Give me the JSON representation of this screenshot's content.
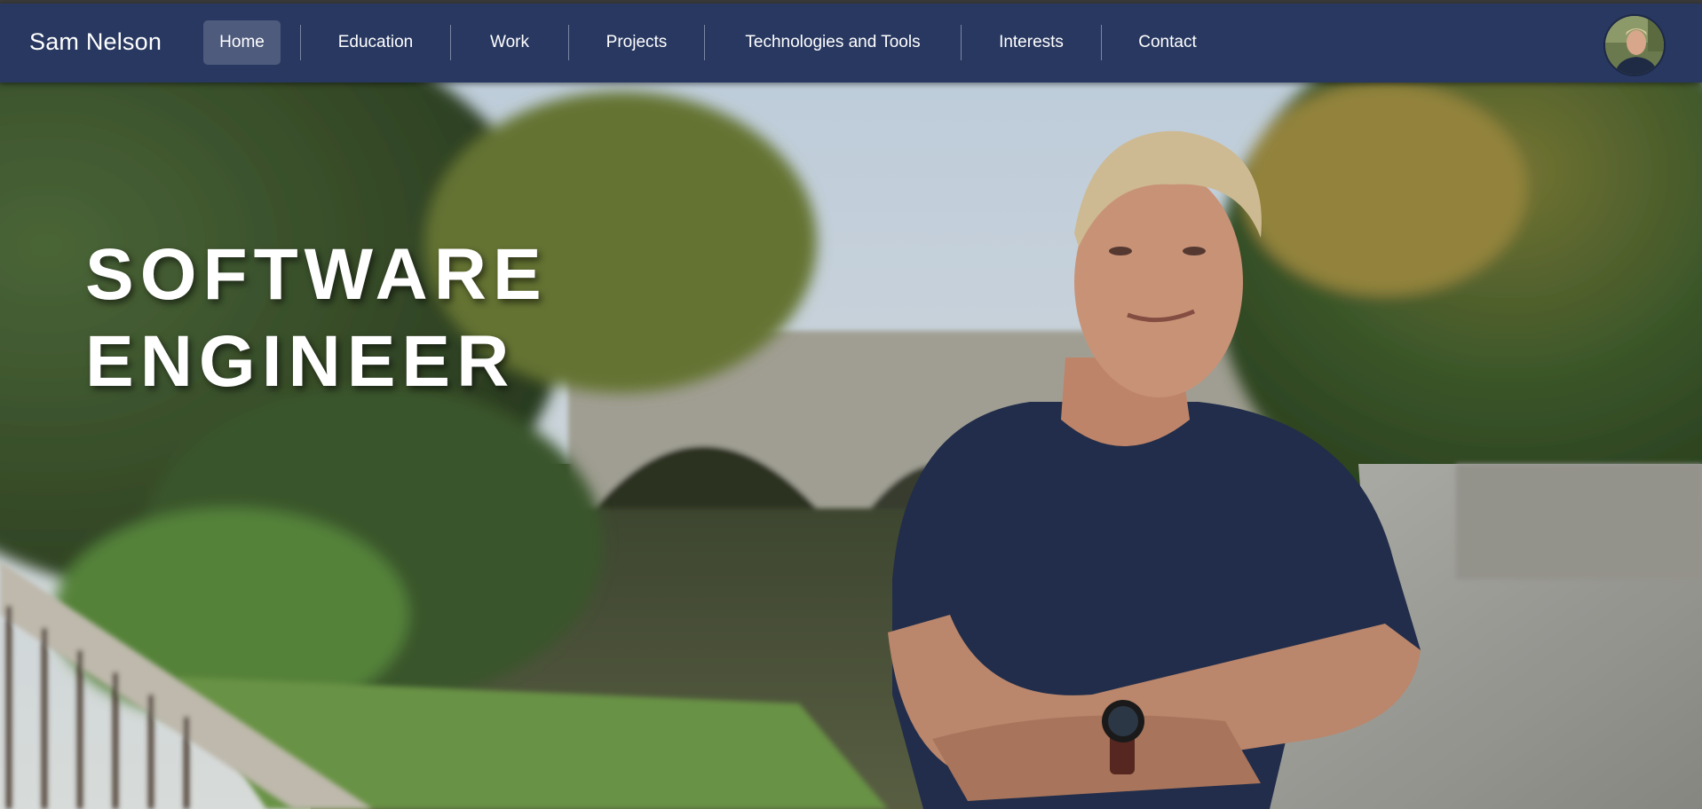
{
  "header": {
    "brand": "Sam Nelson",
    "nav": [
      {
        "label": "Home",
        "active": true
      },
      {
        "label": "Education",
        "active": false
      },
      {
        "label": "Work",
        "active": false
      },
      {
        "label": "Projects",
        "active": false
      },
      {
        "label": "Technologies and Tools",
        "active": false
      },
      {
        "label": "Interests",
        "active": false
      },
      {
        "label": "Contact",
        "active": false
      }
    ],
    "avatar_icon": "profile-avatar"
  },
  "hero": {
    "headline_line1": "SOFTWARE",
    "headline_line2": "ENGINEER"
  },
  "colors": {
    "navbar": "#283860",
    "active_tab": "#4e5b7d",
    "text": "#ffffff"
  }
}
